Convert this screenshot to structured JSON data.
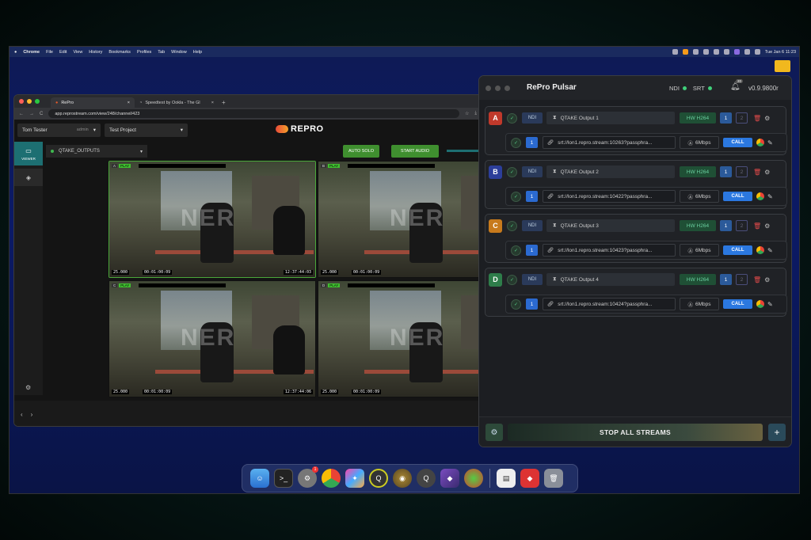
{
  "menubar": {
    "app": "Chrome",
    "items": [
      "File",
      "Edit",
      "View",
      "History",
      "Bookmarks",
      "Profiles",
      "Tab",
      "Window",
      "Help"
    ],
    "clock": "Tue Jan 6 11:23"
  },
  "browser": {
    "tabs": [
      {
        "label": "RePro",
        "close": "×"
      },
      {
        "label": "Speedtest by Ookla - The Gl",
        "close": "×"
      }
    ],
    "new_tab": "+",
    "url": "app.reprostream.com/view/248/channel/423",
    "nav": {
      "back": "←",
      "forward": "→",
      "reload": "C",
      "star": "☆",
      "download": "⤓"
    }
  },
  "app": {
    "user": "Tom Tester",
    "role": "admin",
    "project": "Test Project",
    "logo": "REPRO",
    "sidebar_viewer": "VIEWER",
    "output_select": "QTAKE_OUTPUTS",
    "auto_solo": "AUTO SOLO",
    "start_audio": "START AUDIO",
    "tiles": [
      {
        "cam": "A",
        "play": "PLAY",
        "fps": "25.000",
        "tc1": "00:01:00:09",
        "tc2": "12:37:44:03"
      },
      {
        "cam": "B",
        "play": "PLAY",
        "fps": "25.000",
        "tc1": "00:01:00:09",
        "tc2": ""
      },
      {
        "cam": "C",
        "play": "PLAY",
        "fps": "25.000",
        "tc1": "00:01:00:09",
        "tc2": "12:37:44:06"
      },
      {
        "cam": "D",
        "play": "PLAY",
        "fps": "25.000",
        "tc1": "00:01:00:09",
        "tc2": ""
      }
    ],
    "watermark": "NER",
    "footer_prev": "‹",
    "footer_next": "›"
  },
  "pulsar": {
    "title": "RePro Pulsar",
    "ndi": "NDI",
    "srt": "SRT",
    "notif_count": "20",
    "version": "v0.9.9800r",
    "outputs": [
      {
        "letter": "A",
        "color": "#c0392b",
        "ndi": "NDI",
        "source": "QTAKE Output 1",
        "hw": "HW H264",
        "n1": "1",
        "n2": "2",
        "idx": "1",
        "srt": "srt://lon1.repro.stream:10263?passphra...",
        "rate": "6Mbps",
        "call": "CALL"
      },
      {
        "letter": "B",
        "color": "#2c3e9a",
        "ndi": "NDI",
        "source": "QTAKE Output 2",
        "hw": "HW H264",
        "n1": "1",
        "n2": "2",
        "idx": "1",
        "srt": "srt://lon1.repro.stream:10422?passphra...",
        "rate": "6Mbps",
        "call": "CALL"
      },
      {
        "letter": "C",
        "color": "#c77a1c",
        "ndi": "NDI",
        "source": "QTAKE Output 3",
        "hw": "HW H264",
        "n1": "1",
        "n2": "2",
        "idx": "1",
        "srt": "srt://lon1.repro.stream:10423?passphra...",
        "rate": "6Mbps",
        "call": "CALL"
      },
      {
        "letter": "D",
        "color": "#2e7d4a",
        "ndi": "NDI",
        "source": "QTAKE Output 4",
        "hw": "HW H264",
        "n1": "1",
        "n2": "2",
        "idx": "1",
        "srt": "srt://lon1.repro.stream:10424?passphra...",
        "rate": "6Mbps",
        "call": "CALL"
      }
    ],
    "stop_all": "STOP ALL STREAMS",
    "add": "+"
  }
}
